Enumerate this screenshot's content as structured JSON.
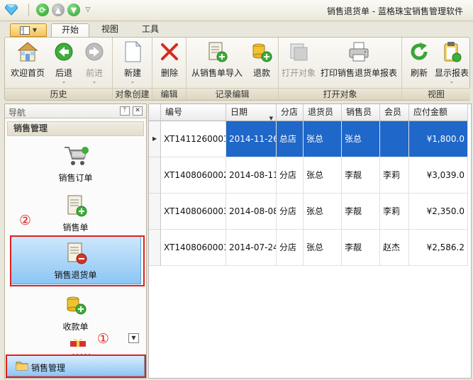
{
  "title_bar": {
    "title": "销售退货单 - 蓝格珠宝销售管理软件"
  },
  "ribbon_tabs": [
    "开始",
    "视图",
    "工具"
  ],
  "ribbon": {
    "groups": [
      {
        "label": "历史",
        "buttons": [
          "欢迎首页",
          "后退",
          "前进"
        ]
      },
      {
        "label": "对象创建",
        "buttons": [
          "新建"
        ]
      },
      {
        "label": "编辑",
        "buttons": [
          "删除"
        ]
      },
      {
        "label": "记录编辑",
        "buttons": [
          "从销售单导入",
          "退款"
        ]
      },
      {
        "label": "打开对象",
        "buttons": [
          "打开对象",
          "打印销售退货单报表"
        ]
      },
      {
        "label": "视图",
        "buttons": [
          "刷新",
          "显示报表"
        ]
      }
    ]
  },
  "nav": {
    "header": "导航",
    "pin": "ᛘ",
    "close": "✕",
    "group_title": "销售管理",
    "items": [
      "销售订单",
      "销售单",
      "销售退货单",
      "收款单"
    ],
    "bottom_label": "销售管理",
    "annotations": [
      "①",
      "②"
    ]
  },
  "grid": {
    "columns": [
      "编号",
      "日期",
      "分店",
      "退货员",
      "销售员",
      "会员",
      "应付金额"
    ],
    "rows": [
      [
        "XT1411260001",
        "2014-11-26",
        "总店",
        "张总",
        "张总",
        "",
        "¥1,800.0"
      ],
      [
        "XT1408060002",
        "2014-08-11",
        "分店",
        "张总",
        "李靓",
        "李莉",
        "¥3,039.0"
      ],
      [
        "XT1408060003",
        "2014-08-08",
        "分店",
        "张总",
        "李靓",
        "李莉",
        "¥2,350.0"
      ],
      [
        "XT1408060001",
        "2014-07-24",
        "分店",
        "张总",
        "李靓",
        "赵杰",
        "¥2,586.2"
      ]
    ],
    "selected_row": 0
  },
  "colors": {
    "selection": "#1f67c9",
    "highlight_box": "#e0201c",
    "nav_selected": "#8cc6f5"
  }
}
